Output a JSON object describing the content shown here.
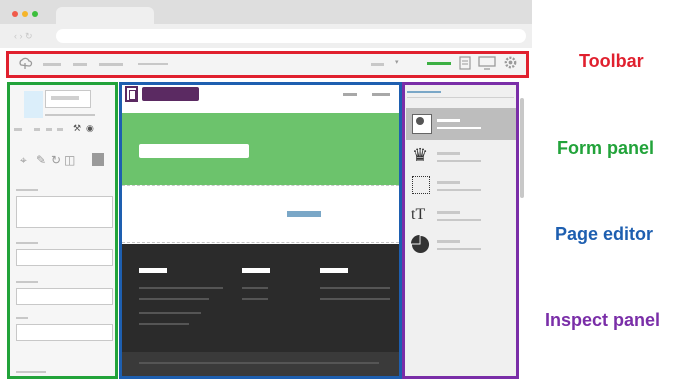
{
  "labels": {
    "toolbar": "Toolbar",
    "form_panel": "Form panel",
    "page_editor": "Page editor",
    "inspect_panel": "Inspect panel"
  },
  "colors": {
    "toolbar": "#e0202e",
    "form_panel": "#22a33a",
    "page_editor": "#1e5fb0",
    "inspect_panel": "#7a2ea8",
    "hero_green": "#6cc36c",
    "footer_dark": "#2b2b2b",
    "logo_purple": "#5b2a62",
    "accent_green": "#3cb043",
    "cta_blue": "#7aa7c7"
  },
  "icons": {
    "toolbar": [
      "cloud-icon",
      "document-icon",
      "monitor-icon",
      "gear-icon"
    ],
    "form": [
      "crop-icon",
      "edit-icon",
      "rotate-icon",
      "trash-icon",
      "image-icon"
    ],
    "inspect": [
      "image-icon",
      "puzzle-icon",
      "grid-icon",
      "text-size-icon",
      "pie-chart-icon"
    ]
  }
}
